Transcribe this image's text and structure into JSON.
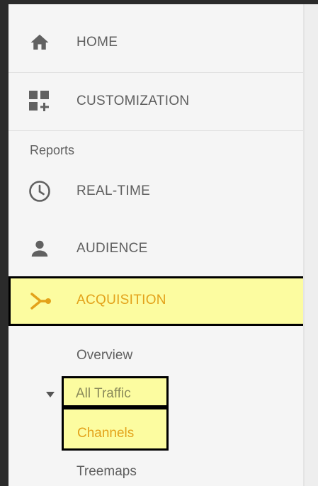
{
  "nav": {
    "home": {
      "label": "HOME",
      "icon": "home-icon"
    },
    "customization": {
      "label": "CUSTOMIZATION",
      "icon": "dashboard-add-icon"
    },
    "reports_header": "Reports",
    "realtime": {
      "label": "REAL-TIME",
      "icon": "clock-icon"
    },
    "audience": {
      "label": "AUDIENCE",
      "icon": "person-icon"
    },
    "acquisition": {
      "label": "ACQUISITION",
      "icon": "acquisition-branch-icon"
    }
  },
  "acquisition_sub": {
    "overview": "Overview",
    "all_traffic": "All Traffic",
    "channels": "Channels",
    "treemaps": "Treemaps"
  },
  "colors": {
    "sidebar_bg": "#f5f5f5",
    "text": "#5f5f5f",
    "accent": "#e3a21a",
    "highlight": "#fcfca0",
    "all_traffic_text": "#8a8a5a"
  }
}
